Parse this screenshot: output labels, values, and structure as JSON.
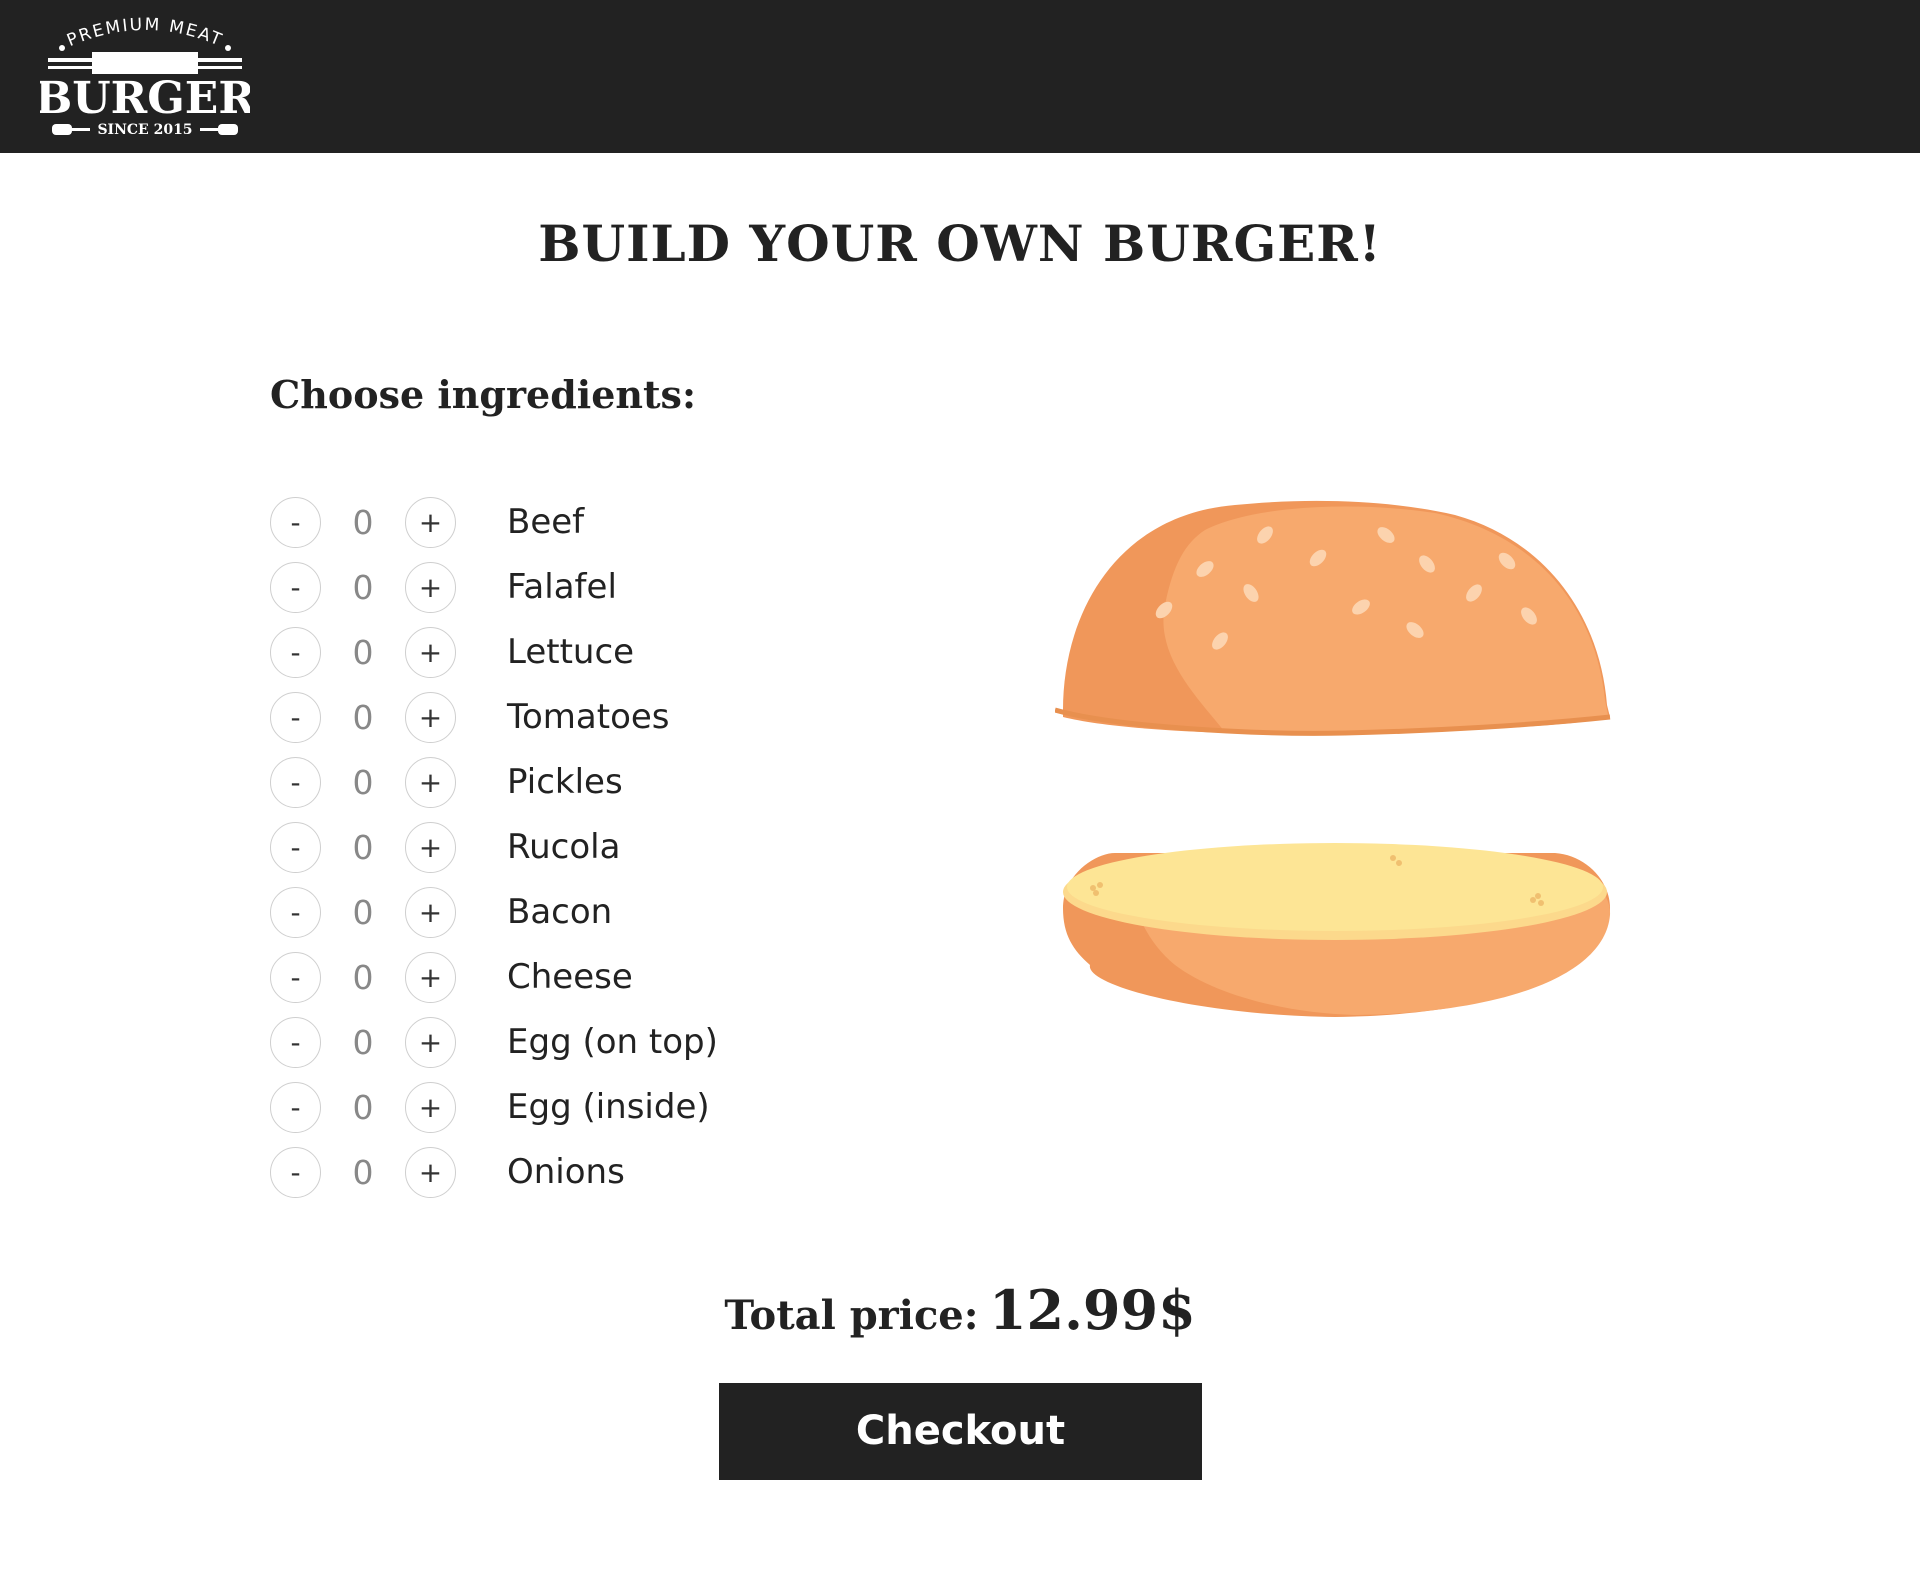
{
  "header": {
    "logo": {
      "top_text": "PREMIUM MEAT",
      "main_text": "BURGER",
      "bottom_text": "SINCE 2015",
      "icon": "burger-logo"
    }
  },
  "main": {
    "title": "BUILD YOUR OWN BURGER!",
    "ingredients_title": "Choose ingredients:",
    "ingredients": [
      {
        "name": "Beef",
        "count": "0",
        "minus": "-",
        "plus": "+"
      },
      {
        "name": "Falafel",
        "count": "0",
        "minus": "-",
        "plus": "+"
      },
      {
        "name": "Lettuce",
        "count": "0",
        "minus": "-",
        "plus": "+"
      },
      {
        "name": "Tomatoes",
        "count": "0",
        "minus": "-",
        "plus": "+"
      },
      {
        "name": "Pickles",
        "count": "0",
        "minus": "-",
        "plus": "+"
      },
      {
        "name": "Rucola",
        "count": "0",
        "minus": "-",
        "plus": "+"
      },
      {
        "name": "Bacon",
        "count": "0",
        "minus": "-",
        "plus": "+"
      },
      {
        "name": "Cheese",
        "count": "0",
        "minus": "-",
        "plus": "+"
      },
      {
        "name": "Egg (on top)",
        "count": "0",
        "minus": "-",
        "plus": "+"
      },
      {
        "name": "Egg (inside)",
        "count": "0",
        "minus": "-",
        "plus": "+"
      },
      {
        "name": "Onions",
        "count": "0",
        "minus": "-",
        "plus": "+"
      }
    ],
    "burger_preview": {
      "top_bun_icon": "top-bun",
      "bottom_bun_icon": "bottom-bun"
    },
    "total_label": "Total price:",
    "total_value": "12.99$",
    "checkout_label": "Checkout"
  },
  "colors": {
    "header_bg": "#222222",
    "text": "#222222",
    "bun": "#F7A96D",
    "bun_shadow": "#F0975A",
    "bun_inside": "#FDE395",
    "button_border": "#cfcfcf",
    "count_text": "#888888",
    "checkout_bg": "#222222"
  }
}
